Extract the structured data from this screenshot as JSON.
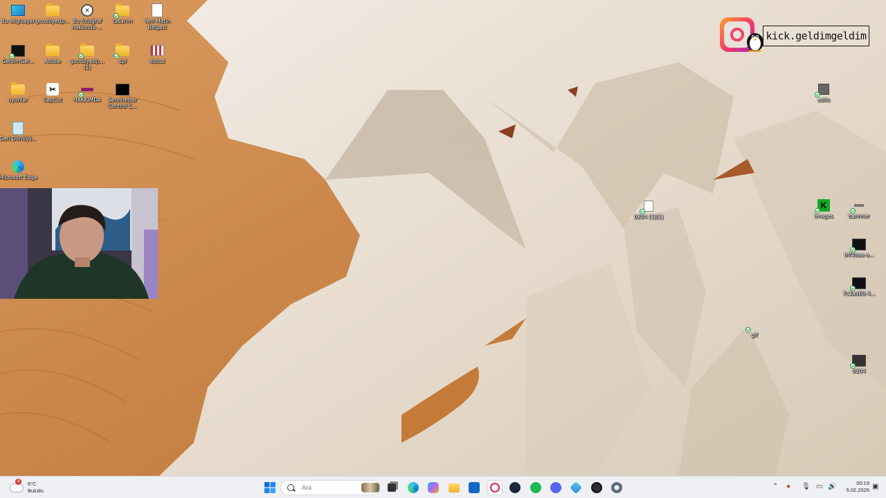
{
  "desktop": {
    "icons": [
      {
        "label": "Bu bilgisayar",
        "icon": "this-pc-icon"
      },
      {
        "label": "goodbyedp...",
        "icon": "folder-icon"
      },
      {
        "label": "Bu fotoğraf hakkında ...",
        "icon": "info-icon"
      },
      {
        "label": "tasarım",
        "icon": "image-folder-icon"
      },
      {
        "label": "Yeni Metin Belgesi",
        "icon": "text-document-icon"
      },
      {
        "label": "GeldimGel...",
        "icon": "shortcut-icon"
      },
      {
        "label": "Adobe",
        "icon": "folder-icon"
      },
      {
        "label": "goodbyedp... (1)",
        "icon": "folder-icon"
      },
      {
        "label": "dpi",
        "icon": "folder-icon"
      },
      {
        "label": "dsdsd",
        "icon": "image-grid-icon"
      },
      {
        "label": "oyunlar",
        "icon": "folder-icon"
      },
      {
        "label": "CapCut",
        "icon": "capcut-icon"
      },
      {
        "label": "HAKKIMDA",
        "icon": "shortcut-icon"
      },
      {
        "label": "Sennheiser Control C...",
        "icon": "sennheiser-icon"
      },
      {
        "label": "Geri Dönüşü...",
        "icon": "recycle-bin-icon"
      },
      {
        "label": "Microsoft Edge",
        "icon": "edge-icon"
      },
      {
        "label": "edits",
        "icon": "shortcut-icon"
      },
      {
        "label": "0204 (1)(1)",
        "icon": "file-icon"
      },
      {
        "label": "images",
        "icon": "images-icon"
      },
      {
        "label": "bannner",
        "icon": "shortcut-icon"
      },
      {
        "label": "bff4baa-a...",
        "icon": "video-icon"
      },
      {
        "label": "7c3ad60-4...",
        "icon": "video-icon"
      },
      {
        "label": "gif",
        "icon": "shortcut-icon"
      },
      {
        "label": "0204",
        "icon": "video-icon"
      }
    ]
  },
  "overlay": {
    "handle": "kick.geldimgeldim"
  },
  "taskbar": {
    "weather": {
      "badge": "4",
      "temp": "6°C",
      "condition": "Bulutlu"
    },
    "search_placeholder": "Ara",
    "apps": [
      "start-icon",
      "search",
      "task-view-icon",
      "edge-icon",
      "copilot-icon",
      "file-explorer-icon",
      "store-icon",
      "opera-gx-icon",
      "steam-icon",
      "spotify-icon",
      "discord-icon",
      "snipping-icon",
      "obs-icon",
      "settings-icon"
    ],
    "tray": [
      "chevron-up-icon",
      "record-icon",
      "microphone-icon",
      "network-icon",
      "speaker-icon"
    ],
    "clock": {
      "time": "00:19",
      "date": "5.02.2026"
    }
  },
  "colors": {
    "taskbar_bg": "#eef0f4",
    "sand": "#c9884f",
    "rock": "#ece4d8",
    "handle_text": "#111111",
    "instagram_gradient": [
      "#f9a22b",
      "#f2386b",
      "#b11fb8"
    ]
  }
}
